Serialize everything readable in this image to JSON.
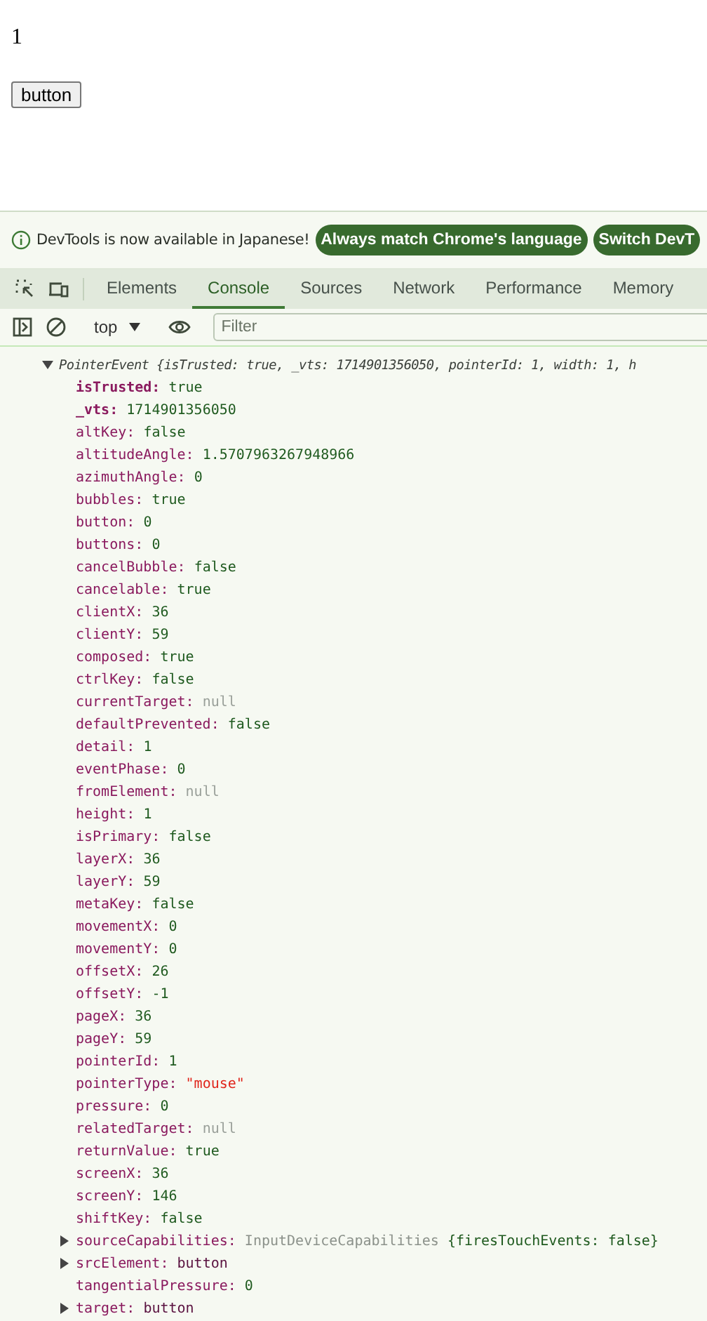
{
  "page": {
    "counter": "1",
    "button": "button"
  },
  "infobar": {
    "message": "DevTools is now available in Japanese!",
    "buttons": [
      "Always match Chrome's language",
      "Switch DevT"
    ]
  },
  "tabs": [
    {
      "label": "Elements",
      "selected": false
    },
    {
      "label": "Console",
      "selected": true
    },
    {
      "label": "Sources",
      "selected": false
    },
    {
      "label": "Network",
      "selected": false
    },
    {
      "label": "Performance",
      "selected": false
    },
    {
      "label": "Memory",
      "selected": false
    }
  ],
  "toolbar": {
    "context": "top",
    "filter_placeholder": "Filter"
  },
  "console": {
    "expanded": true,
    "summary": "PointerEvent {isTrusted: true, _vts: 1714901356050, pointerId: 1, width: 1, h",
    "properties": [
      {
        "key": "isTrusted:",
        "value": "true",
        "kind": "bool",
        "own": true,
        "expandable": false
      },
      {
        "key": "_vts:",
        "value": "1714901356050",
        "kind": "number",
        "own": true,
        "expandable": false
      },
      {
        "key": "altKey:",
        "value": "false",
        "kind": "bool",
        "own": false,
        "expandable": false
      },
      {
        "key": "altitudeAngle:",
        "value": "1.5707963267948966",
        "kind": "number",
        "own": false,
        "expandable": false
      },
      {
        "key": "azimuthAngle:",
        "value": "0",
        "kind": "number",
        "own": false,
        "expandable": false
      },
      {
        "key": "bubbles:",
        "value": "true",
        "kind": "bool",
        "own": false,
        "expandable": false
      },
      {
        "key": "button:",
        "value": "0",
        "kind": "number",
        "own": false,
        "expandable": false
      },
      {
        "key": "buttons:",
        "value": "0",
        "kind": "number",
        "own": false,
        "expandable": false
      },
      {
        "key": "cancelBubble:",
        "value": "false",
        "kind": "bool",
        "own": false,
        "expandable": false
      },
      {
        "key": "cancelable:",
        "value": "true",
        "kind": "bool",
        "own": false,
        "expandable": false
      },
      {
        "key": "clientX:",
        "value": "36",
        "kind": "number",
        "own": false,
        "expandable": false
      },
      {
        "key": "clientY:",
        "value": "59",
        "kind": "number",
        "own": false,
        "expandable": false
      },
      {
        "key": "composed:",
        "value": "true",
        "kind": "bool",
        "own": false,
        "expandable": false
      },
      {
        "key": "ctrlKey:",
        "value": "false",
        "kind": "bool",
        "own": false,
        "expandable": false
      },
      {
        "key": "currentTarget:",
        "value": "null",
        "kind": "null",
        "own": false,
        "expandable": false
      },
      {
        "key": "defaultPrevented:",
        "value": "false",
        "kind": "bool",
        "own": false,
        "expandable": false
      },
      {
        "key": "detail:",
        "value": "1",
        "kind": "number",
        "own": false,
        "expandable": false
      },
      {
        "key": "eventPhase:",
        "value": "0",
        "kind": "number",
        "own": false,
        "expandable": false
      },
      {
        "key": "fromElement:",
        "value": "null",
        "kind": "null",
        "own": false,
        "expandable": false
      },
      {
        "key": "height:",
        "value": "1",
        "kind": "number",
        "own": false,
        "expandable": false
      },
      {
        "key": "isPrimary:",
        "value": "false",
        "kind": "bool",
        "own": false,
        "expandable": false
      },
      {
        "key": "layerX:",
        "value": "36",
        "kind": "number",
        "own": false,
        "expandable": false
      },
      {
        "key": "layerY:",
        "value": "59",
        "kind": "number",
        "own": false,
        "expandable": false
      },
      {
        "key": "metaKey:",
        "value": "false",
        "kind": "bool",
        "own": false,
        "expandable": false
      },
      {
        "key": "movementX:",
        "value": "0",
        "kind": "number",
        "own": false,
        "expandable": false
      },
      {
        "key": "movementY:",
        "value": "0",
        "kind": "number",
        "own": false,
        "expandable": false
      },
      {
        "key": "offsetX:",
        "value": "26",
        "kind": "number",
        "own": false,
        "expandable": false
      },
      {
        "key": "offsetY:",
        "value": "-1",
        "kind": "number",
        "own": false,
        "expandable": false
      },
      {
        "key": "pageX:",
        "value": "36",
        "kind": "number",
        "own": false,
        "expandable": false
      },
      {
        "key": "pageY:",
        "value": "59",
        "kind": "number",
        "own": false,
        "expandable": false
      },
      {
        "key": "pointerId:",
        "value": "1",
        "kind": "number",
        "own": false,
        "expandable": false
      },
      {
        "key": "pointerType:",
        "value": "\"mouse\"",
        "kind": "string",
        "own": false,
        "expandable": false
      },
      {
        "key": "pressure:",
        "value": "0",
        "kind": "number",
        "own": false,
        "expandable": false
      },
      {
        "key": "relatedTarget:",
        "value": "null",
        "kind": "null",
        "own": false,
        "expandable": false
      },
      {
        "key": "returnValue:",
        "value": "true",
        "kind": "bool",
        "own": false,
        "expandable": false
      },
      {
        "key": "screenX:",
        "value": "36",
        "kind": "number",
        "own": false,
        "expandable": false
      },
      {
        "key": "screenY:",
        "value": "146",
        "kind": "number",
        "own": false,
        "expandable": false
      },
      {
        "key": "shiftKey:",
        "value": "false",
        "kind": "bool",
        "own": false,
        "expandable": false
      },
      {
        "key": "sourceCapabilities:",
        "value": "InputDeviceCapabilities",
        "preview": "{firesTouchEvents: false}",
        "kind": "object",
        "own": false,
        "expandable": true
      },
      {
        "key": "srcElement:",
        "value": "button",
        "kind": "node",
        "own": false,
        "expandable": true
      },
      {
        "key": "tangentialPressure:",
        "value": "0",
        "kind": "number",
        "own": false,
        "expandable": false
      },
      {
        "key": "target:",
        "value": "button",
        "kind": "node",
        "own": false,
        "expandable": true
      }
    ]
  }
}
